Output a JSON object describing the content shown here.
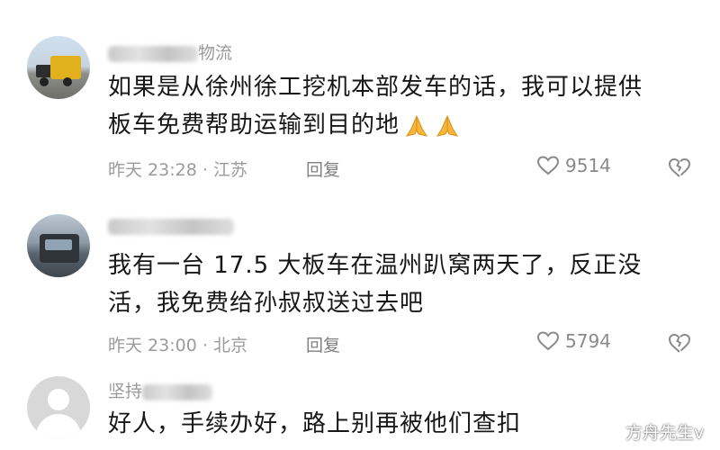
{
  "comments": [
    {
      "username_suffix": "物流",
      "text_line1": "如果是从徐州徐工挖机本部发车的话，我可以提供",
      "text_line2": "板车免费帮助运输到目的地",
      "emoji": "pray-emoji",
      "time": "昨天 23:28",
      "location": "江苏",
      "reply_label": "回复",
      "likes": "9514"
    },
    {
      "username_suffix": "",
      "text_line1": "我有一台 17.5 大板车在温州趴窝两天了，反正没",
      "text_line2": "活，我免费给孙叔叔送过去吧",
      "time": "昨天 23:00",
      "location": "北京",
      "reply_label": "回复",
      "likes": "5794"
    },
    {
      "username_prefix": "坚持",
      "text_line1": "好人，手续办好，路上别再被他们查扣"
    }
  ],
  "meta_separator": "·",
  "watermark": "方舟先生v",
  "colors": {
    "text": "#171717",
    "meta": "#9b9b9b",
    "background": "#ffffff"
  },
  "icons": [
    "heart-outline-icon",
    "broken-heart-icon",
    "pray-emoji",
    "weibo-logo-icon"
  ]
}
